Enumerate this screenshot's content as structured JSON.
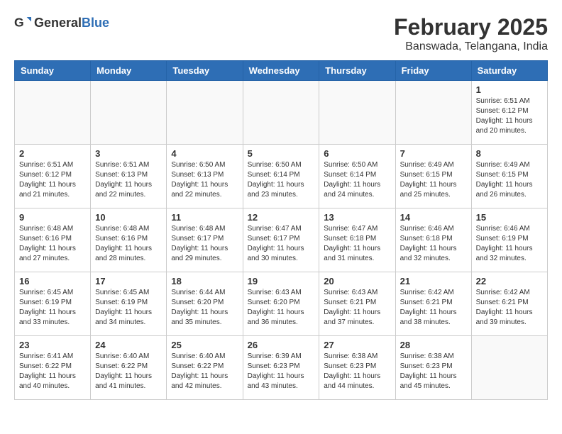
{
  "header": {
    "logo_general": "General",
    "logo_blue": "Blue",
    "month_title": "February 2025",
    "location": "Banswada, Telangana, India"
  },
  "weekdays": [
    "Sunday",
    "Monday",
    "Tuesday",
    "Wednesday",
    "Thursday",
    "Friday",
    "Saturday"
  ],
  "weeks": [
    [
      {
        "day": "",
        "info": ""
      },
      {
        "day": "",
        "info": ""
      },
      {
        "day": "",
        "info": ""
      },
      {
        "day": "",
        "info": ""
      },
      {
        "day": "",
        "info": ""
      },
      {
        "day": "",
        "info": ""
      },
      {
        "day": "1",
        "info": "Sunrise: 6:51 AM\nSunset: 6:12 PM\nDaylight: 11 hours and 20 minutes."
      }
    ],
    [
      {
        "day": "2",
        "info": "Sunrise: 6:51 AM\nSunset: 6:12 PM\nDaylight: 11 hours and 21 minutes."
      },
      {
        "day": "3",
        "info": "Sunrise: 6:51 AM\nSunset: 6:13 PM\nDaylight: 11 hours and 22 minutes."
      },
      {
        "day": "4",
        "info": "Sunrise: 6:50 AM\nSunset: 6:13 PM\nDaylight: 11 hours and 22 minutes."
      },
      {
        "day": "5",
        "info": "Sunrise: 6:50 AM\nSunset: 6:14 PM\nDaylight: 11 hours and 23 minutes."
      },
      {
        "day": "6",
        "info": "Sunrise: 6:50 AM\nSunset: 6:14 PM\nDaylight: 11 hours and 24 minutes."
      },
      {
        "day": "7",
        "info": "Sunrise: 6:49 AM\nSunset: 6:15 PM\nDaylight: 11 hours and 25 minutes."
      },
      {
        "day": "8",
        "info": "Sunrise: 6:49 AM\nSunset: 6:15 PM\nDaylight: 11 hours and 26 minutes."
      }
    ],
    [
      {
        "day": "9",
        "info": "Sunrise: 6:48 AM\nSunset: 6:16 PM\nDaylight: 11 hours and 27 minutes."
      },
      {
        "day": "10",
        "info": "Sunrise: 6:48 AM\nSunset: 6:16 PM\nDaylight: 11 hours and 28 minutes."
      },
      {
        "day": "11",
        "info": "Sunrise: 6:48 AM\nSunset: 6:17 PM\nDaylight: 11 hours and 29 minutes."
      },
      {
        "day": "12",
        "info": "Sunrise: 6:47 AM\nSunset: 6:17 PM\nDaylight: 11 hours and 30 minutes."
      },
      {
        "day": "13",
        "info": "Sunrise: 6:47 AM\nSunset: 6:18 PM\nDaylight: 11 hours and 31 minutes."
      },
      {
        "day": "14",
        "info": "Sunrise: 6:46 AM\nSunset: 6:18 PM\nDaylight: 11 hours and 32 minutes."
      },
      {
        "day": "15",
        "info": "Sunrise: 6:46 AM\nSunset: 6:19 PM\nDaylight: 11 hours and 32 minutes."
      }
    ],
    [
      {
        "day": "16",
        "info": "Sunrise: 6:45 AM\nSunset: 6:19 PM\nDaylight: 11 hours and 33 minutes."
      },
      {
        "day": "17",
        "info": "Sunrise: 6:45 AM\nSunset: 6:19 PM\nDaylight: 11 hours and 34 minutes."
      },
      {
        "day": "18",
        "info": "Sunrise: 6:44 AM\nSunset: 6:20 PM\nDaylight: 11 hours and 35 minutes."
      },
      {
        "day": "19",
        "info": "Sunrise: 6:43 AM\nSunset: 6:20 PM\nDaylight: 11 hours and 36 minutes."
      },
      {
        "day": "20",
        "info": "Sunrise: 6:43 AM\nSunset: 6:21 PM\nDaylight: 11 hours and 37 minutes."
      },
      {
        "day": "21",
        "info": "Sunrise: 6:42 AM\nSunset: 6:21 PM\nDaylight: 11 hours and 38 minutes."
      },
      {
        "day": "22",
        "info": "Sunrise: 6:42 AM\nSunset: 6:21 PM\nDaylight: 11 hours and 39 minutes."
      }
    ],
    [
      {
        "day": "23",
        "info": "Sunrise: 6:41 AM\nSunset: 6:22 PM\nDaylight: 11 hours and 40 minutes."
      },
      {
        "day": "24",
        "info": "Sunrise: 6:40 AM\nSunset: 6:22 PM\nDaylight: 11 hours and 41 minutes."
      },
      {
        "day": "25",
        "info": "Sunrise: 6:40 AM\nSunset: 6:22 PM\nDaylight: 11 hours and 42 minutes."
      },
      {
        "day": "26",
        "info": "Sunrise: 6:39 AM\nSunset: 6:23 PM\nDaylight: 11 hours and 43 minutes."
      },
      {
        "day": "27",
        "info": "Sunrise: 6:38 AM\nSunset: 6:23 PM\nDaylight: 11 hours and 44 minutes."
      },
      {
        "day": "28",
        "info": "Sunrise: 6:38 AM\nSunset: 6:23 PM\nDaylight: 11 hours and 45 minutes."
      },
      {
        "day": "",
        "info": ""
      }
    ]
  ]
}
